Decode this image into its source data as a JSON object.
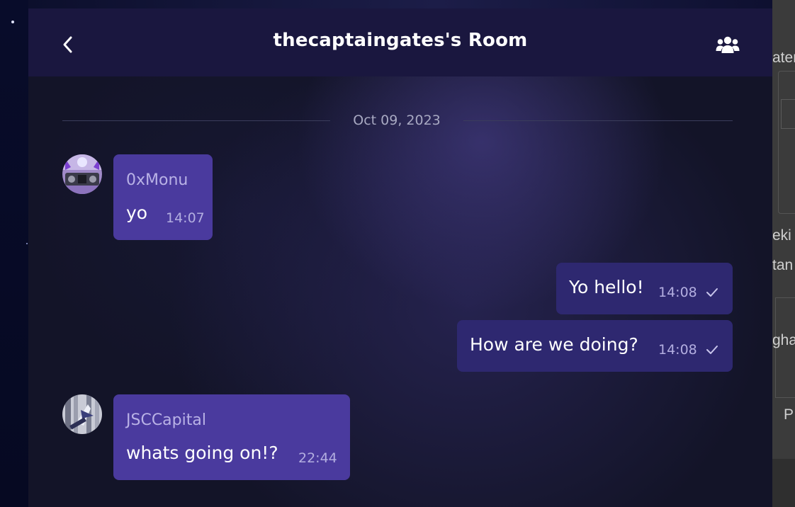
{
  "header": {
    "title": "thecaptaingates's Room",
    "back_icon": "chevron-left-icon",
    "members_icon": "users-icon"
  },
  "date_divider": "Oct 09, 2023",
  "messages": [
    {
      "direction": "incoming",
      "sender": "0xMonu",
      "text": "yo",
      "time": "14:07"
    },
    {
      "direction": "outgoing",
      "text": "Yo hello!",
      "time": "14:08",
      "status_icon": "check-icon"
    },
    {
      "direction": "outgoing",
      "text": "How are we doing?",
      "time": "14:08",
      "status_icon": "check-icon"
    },
    {
      "direction": "incoming",
      "sender": "JSCCapital",
      "text": "whats going on!?",
      "time": "22:44"
    }
  ],
  "map_labels": [
    "ater",
    "eki",
    "tan",
    "gha",
    "P"
  ],
  "colors": {
    "header_bg": "#1a173f",
    "incoming_bubble": "#4a3a9e",
    "outgoing_bubble": "#2e2870",
    "panel_bg": "#131428"
  }
}
